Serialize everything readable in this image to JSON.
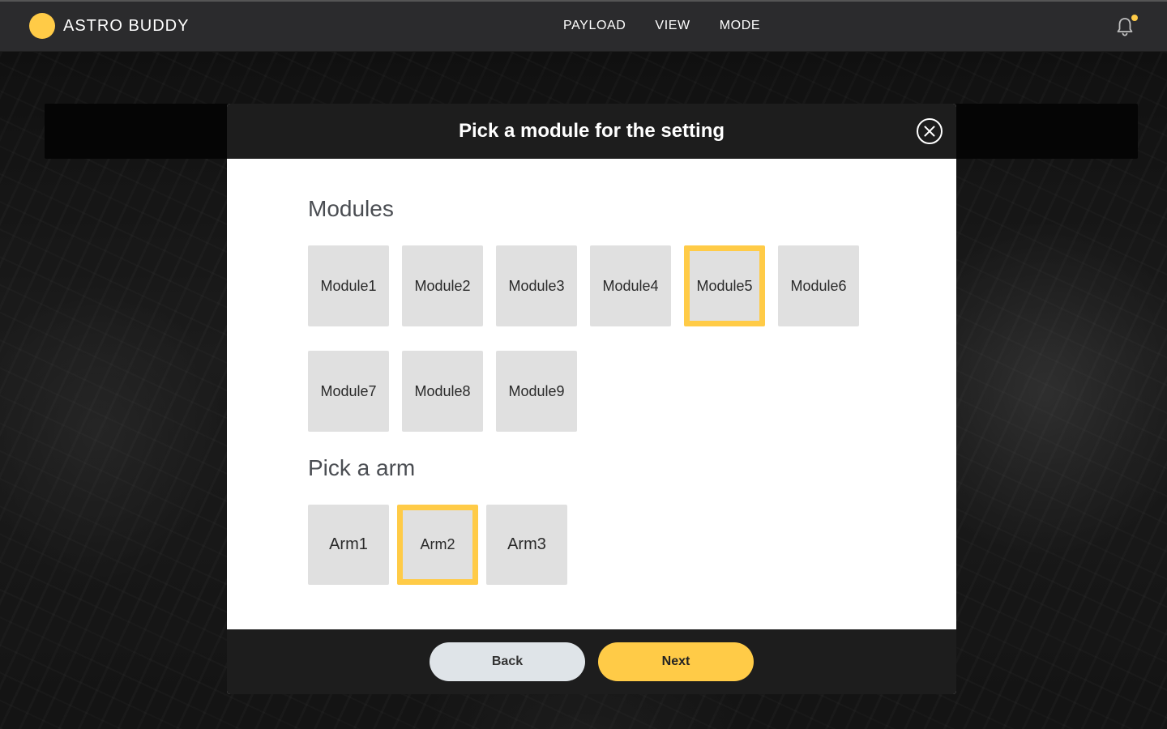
{
  "app": {
    "title": "ASTRO BUDDY"
  },
  "nav": {
    "items": [
      "PAYLOAD",
      "VIEW",
      "MODE"
    ]
  },
  "modal": {
    "title": "Pick a module for the setting",
    "modules_title": "Modules",
    "modules": [
      "Module1",
      "Module2",
      "Module3",
      "Module4",
      "Module5",
      "Module6",
      "Module7",
      "Module8",
      "Module9"
    ],
    "selected_module": "Module5",
    "arms_title": "Pick a arm",
    "arms": [
      "Arm1",
      "Arm2",
      "Arm3"
    ],
    "selected_arm": "Arm2",
    "back_label": "Back",
    "next_label": "Next"
  },
  "colors": {
    "accent": "#ffcb47",
    "header": "#1d1d1d",
    "tile": "#e0e0e0",
    "back_button": "#dfe4e8"
  },
  "icons": {
    "logo": "circle-logo-icon",
    "notifications": "bell-icon",
    "close": "close-icon"
  }
}
